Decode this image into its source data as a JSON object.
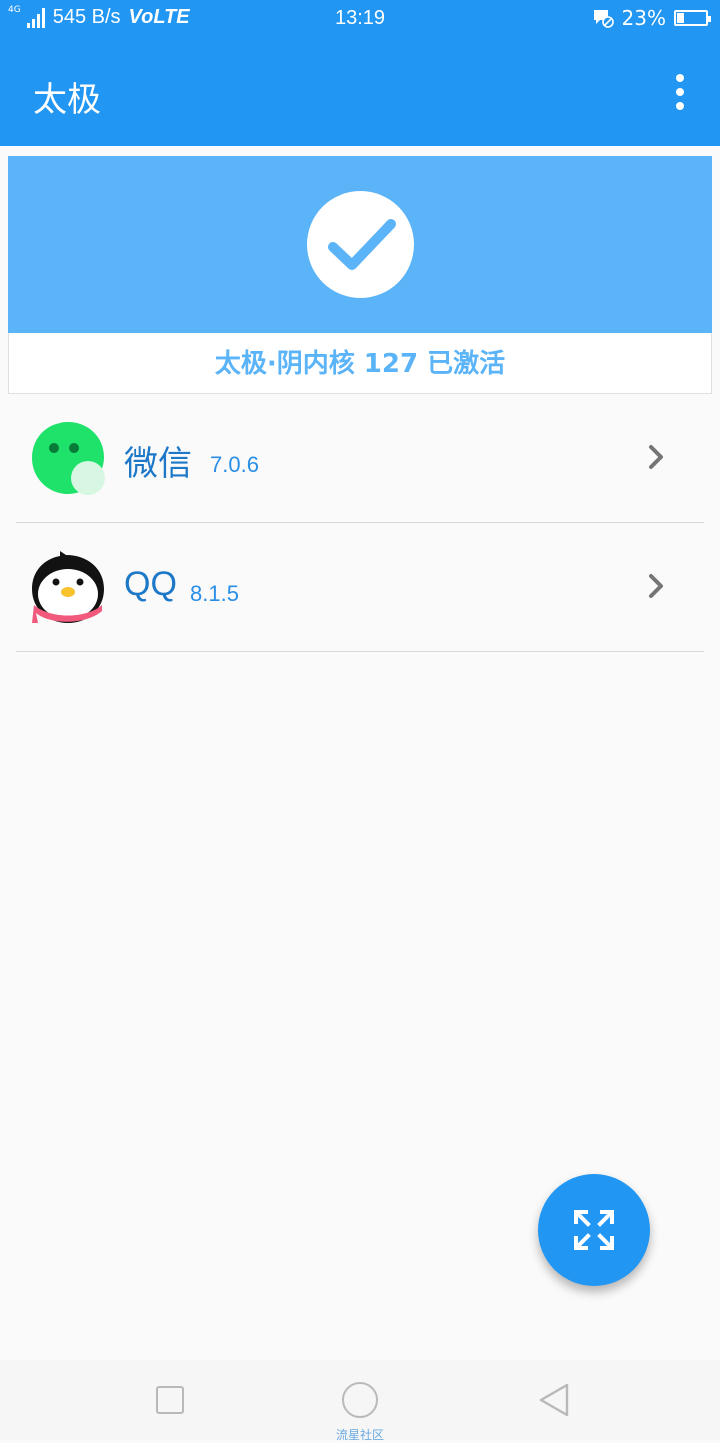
{
  "status_bar": {
    "network_label": "4G",
    "speed": "545 B/s",
    "volte": "VoLTE",
    "time": "13:19",
    "battery_percent": "23%",
    "battery_level": 0.23
  },
  "app_bar": {
    "title": "太极"
  },
  "activation_card": {
    "status_text": "太极·阴内核 127 已激活",
    "banner_color": "#5bb3f8"
  },
  "apps": [
    {
      "name": "微信",
      "version": "7.0.6"
    },
    {
      "name": "QQ",
      "version": "8.1.5"
    }
  ],
  "nav_bar": {
    "watermark": "流星社区"
  },
  "colors": {
    "primary": "#2196f3",
    "accent_text": "#1e78c8"
  }
}
